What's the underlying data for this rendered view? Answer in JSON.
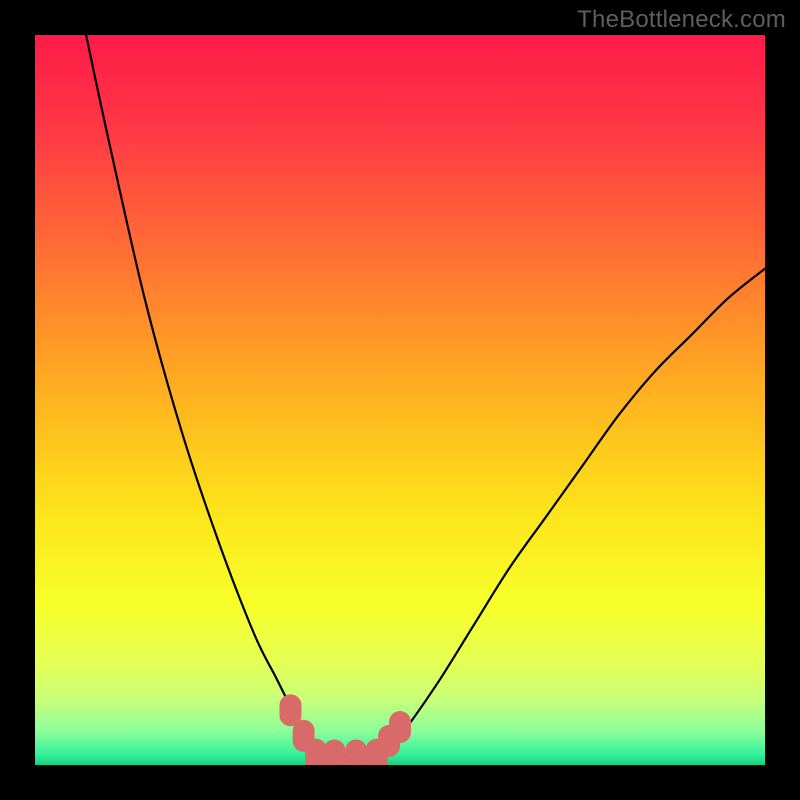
{
  "watermark": "TheBottleneck.com",
  "chart_data": {
    "type": "line",
    "title": "",
    "xlabel": "",
    "ylabel": "",
    "xlim": [
      0,
      100
    ],
    "ylim": [
      0,
      100
    ],
    "series": [
      {
        "name": "curve-left",
        "x": [
          7,
          10,
          15,
          20,
          25,
          30,
          33,
          35,
          37,
          38.5
        ],
        "values": [
          100,
          86,
          64,
          46,
          31,
          18,
          12,
          8,
          4,
          1.5
        ]
      },
      {
        "name": "curve-right",
        "x": [
          47,
          50,
          55,
          60,
          65,
          70,
          75,
          80,
          85,
          90,
          95,
          100
        ],
        "values": [
          1.5,
          4,
          11,
          19,
          27,
          34,
          41,
          48,
          54,
          59,
          64,
          68
        ]
      },
      {
        "name": "floor",
        "x": [
          38.5,
          47
        ],
        "values": [
          1.3,
          1.3
        ]
      }
    ],
    "markers": [
      {
        "name": "m1",
        "x": 35.0,
        "y": 7.5
      },
      {
        "name": "m2",
        "x": 36.8,
        "y": 4.0
      },
      {
        "name": "m3",
        "x": 38.5,
        "y": 1.4
      },
      {
        "name": "m4",
        "x": 41.0,
        "y": 1.3
      },
      {
        "name": "m5",
        "x": 44.0,
        "y": 1.3
      },
      {
        "name": "m6",
        "x": 46.8,
        "y": 1.4
      },
      {
        "name": "m7",
        "x": 48.5,
        "y": 3.3
      },
      {
        "name": "m8",
        "x": 50.0,
        "y": 5.2
      }
    ],
    "background_gradient": {
      "stops": [
        {
          "offset": 0.0,
          "color": "#ff1b48"
        },
        {
          "offset": 0.12,
          "color": "#ff3546"
        },
        {
          "offset": 0.3,
          "color": "#ff6f33"
        },
        {
          "offset": 0.5,
          "color": "#ffb41f"
        },
        {
          "offset": 0.65,
          "color": "#fde31a"
        },
        {
          "offset": 0.78,
          "color": "#f7ff2a"
        },
        {
          "offset": 0.86,
          "color": "#e5ff55"
        },
        {
          "offset": 0.91,
          "color": "#c8ff7a"
        },
        {
          "offset": 0.955,
          "color": "#8aff9a"
        },
        {
          "offset": 0.985,
          "color": "#35f09a"
        },
        {
          "offset": 1.0,
          "color": "#17d183"
        }
      ]
    },
    "curve_color": "#000000",
    "marker_color": "#d96a6a"
  }
}
